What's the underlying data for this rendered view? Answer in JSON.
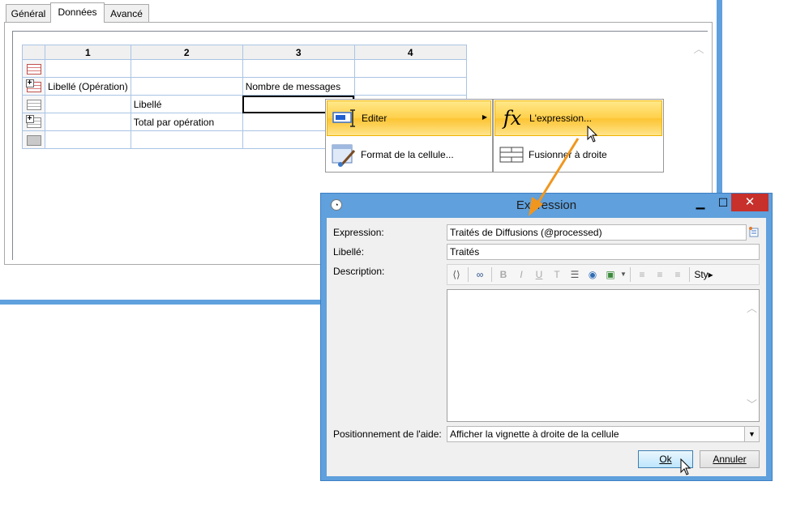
{
  "tabs": [
    {
      "label": "Général"
    },
    {
      "label": "Données"
    },
    {
      "label": "Avancé"
    }
  ],
  "grid": {
    "columns": [
      "1",
      "2",
      "3",
      "4"
    ],
    "rows": [
      {
        "icon": "table-header-row-icon",
        "cells": [
          "",
          "",
          "",
          ""
        ]
      },
      {
        "icon": "group-expand-row-icon",
        "cells": [
          "Libellé (Opération)",
          "",
          "Nombre de messages",
          ""
        ]
      },
      {
        "icon": "table-row-icon",
        "cells": [
          "",
          "Libellé",
          "",
          ""
        ]
      },
      {
        "icon": "group-total-row-icon",
        "cells": [
          "",
          "Total par opération",
          "",
          ""
        ]
      },
      {
        "icon": "table-footer-row-icon",
        "cells": [
          "",
          "",
          "",
          ""
        ]
      }
    ]
  },
  "context_menu": {
    "items": [
      {
        "label": "Editer",
        "icon": "edit-cell-icon",
        "has_submenu": true
      },
      {
        "label": "Format de la cellule...",
        "icon": "format-cell-icon"
      }
    ],
    "submenu": [
      {
        "label": "L'expression...",
        "icon": "fx-icon"
      },
      {
        "label": "Fusionner à droite",
        "icon": "merge-right-icon"
      }
    ]
  },
  "dialog": {
    "title": "Expression",
    "expression_label": "Expression:",
    "expression_value": "Traités de Diffusions (@processed)",
    "libelle_label": "Libellé:",
    "libelle_value": "Traités",
    "description_label": "Description:",
    "toolbar": {
      "style_label": "Sty"
    },
    "help_position_label": "Positionnement de l'aide:",
    "help_position_value": "Afficher la vignette à droite de la cellule",
    "ok_label": "Ok",
    "cancel_label": "Annuler"
  },
  "colors": {
    "window_frame": "#5fa0dd",
    "menu_highlight": "#ffd04a",
    "close_button": "#c7302b",
    "arrow": "#f0961e"
  }
}
